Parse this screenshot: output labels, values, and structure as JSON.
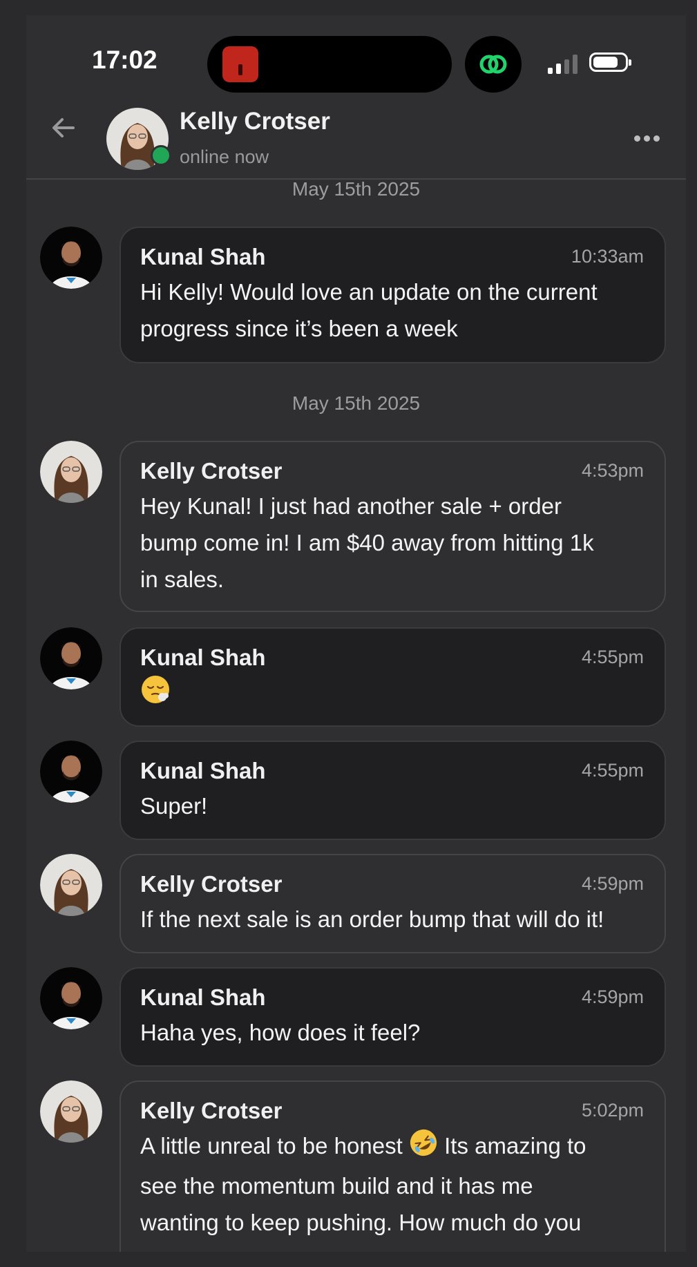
{
  "status_bar": {
    "time": "17:02"
  },
  "header": {
    "name": "Kelly Crotser",
    "status": "online now"
  },
  "messages": [
    {
      "date_label": "May 15th 2025"
    },
    {
      "sender": "Kunal Shah",
      "time": "10:33am",
      "lines": [
        "Hi Kelly! Would love an update on the current",
        "progress since it’s been a week"
      ]
    },
    {
      "date_label": "May 15th 2025"
    },
    {
      "sender": "Kelly Crotser",
      "time": "4:53pm",
      "lines": [
        "Hey Kunal! I just had another sale + order",
        "bump come in! I am $40 away from hitting 1k",
        "in sales."
      ]
    },
    {
      "sender": "Kunal Shah",
      "time": "4:55pm",
      "emoji": "relieved-face-with-steam"
    },
    {
      "sender": "Kunal Shah",
      "time": "4:55pm",
      "lines": [
        "Super!"
      ]
    },
    {
      "sender": "Kelly Crotser",
      "time": "4:59pm",
      "lines": [
        "If the next sale is an order bump that will do it!"
      ]
    },
    {
      "sender": "Kunal Shah",
      "time": "4:59pm",
      "lines": [
        "Haha yes, how does it feel?"
      ]
    },
    {
      "sender": "Kelly Crotser",
      "time": "5:02pm",
      "lines": [
        "A little unreal to be honest",
        "Its amazing to",
        "see the momentum build and it has me",
        "wanting to keep pushing. How much do you"
      ],
      "emoji": "rolling-on-the-floor-laughing"
    }
  ],
  "colors": {
    "background": "#2f2f31",
    "kunal_bubble": "#1f1f21",
    "kelly_bubble": "#2f2f31",
    "online": "#21a557"
  }
}
